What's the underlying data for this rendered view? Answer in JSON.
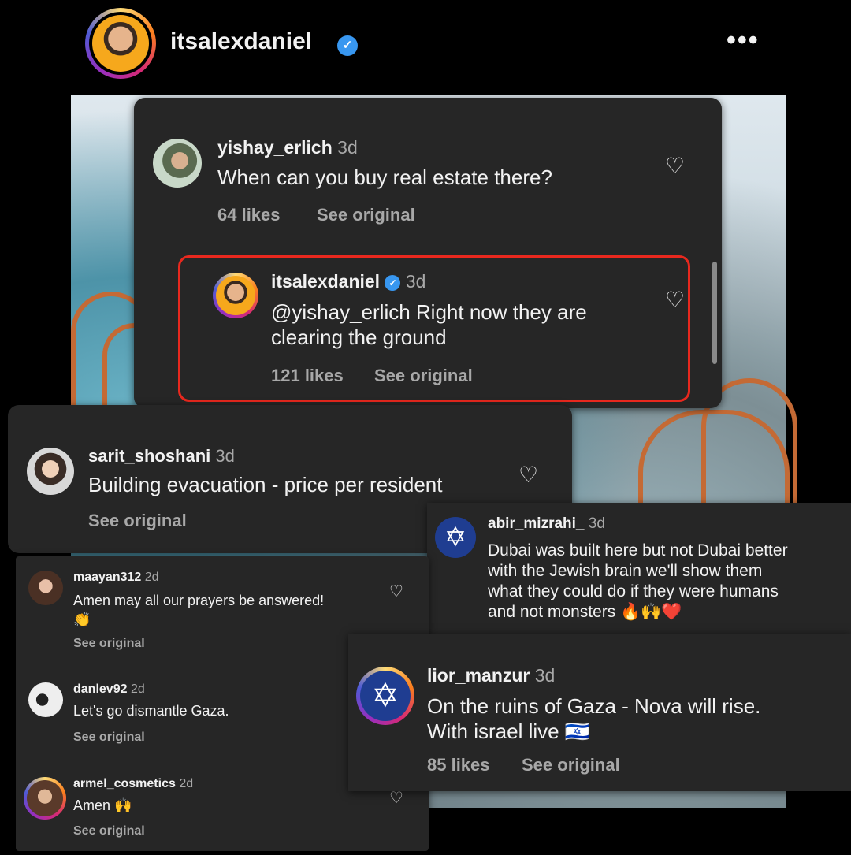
{
  "header": {
    "username": "itsalexdaniel",
    "verified_mark": "✓",
    "more_label": "•••"
  },
  "panel_main": {
    "comment": {
      "username": "yishay_erlich",
      "time": "3d",
      "text": "When can you buy real estate there?",
      "likes": "64 likes",
      "see_original": "See original"
    },
    "reply": {
      "username": "itsalexdaniel",
      "verified_mark": "✓",
      "time": "3d",
      "text": "@yishay_erlich Right now they are\nclearing the ground",
      "likes": "121 likes",
      "see_original": "See original"
    }
  },
  "panel_sarit": {
    "username": "sarit_shoshani",
    "time": "3d",
    "text": "Building evacuation - price per resident",
    "see_original": "See original"
  },
  "panel_abir": {
    "username": "abir_mizrahi_",
    "time": "3d",
    "text": "Dubai was built here but not Dubai better\nwith the Jewish brain we'll show them\nwhat they could do if they were humans\nand not monsters 🔥🙌❤️"
  },
  "panel_left": {
    "comments": [
      {
        "username": "maayan312",
        "time": "2d",
        "text": "Amen may all our prayers be answered!\n👏",
        "see_original": "See original"
      },
      {
        "username": "danlev92",
        "time": "2d",
        "text": "Let's go dismantle Gaza.",
        "see_original": "See original"
      },
      {
        "username": "armel_cosmetics",
        "time": "2d",
        "text": "Amen 🙌",
        "see_original": "See original"
      }
    ]
  },
  "panel_lior": {
    "username": "lior_manzur",
    "time": "3d",
    "text": "On the ruins of Gaza - Nova will rise.\nWith israel live 🇮🇱",
    "likes": "85 likes",
    "see_original": "See original"
  },
  "icons": {
    "heart": "♡",
    "star": "✡"
  },
  "colors": {
    "highlight": "#e8281e",
    "verified": "#3897f0",
    "panel": "#262626"
  }
}
